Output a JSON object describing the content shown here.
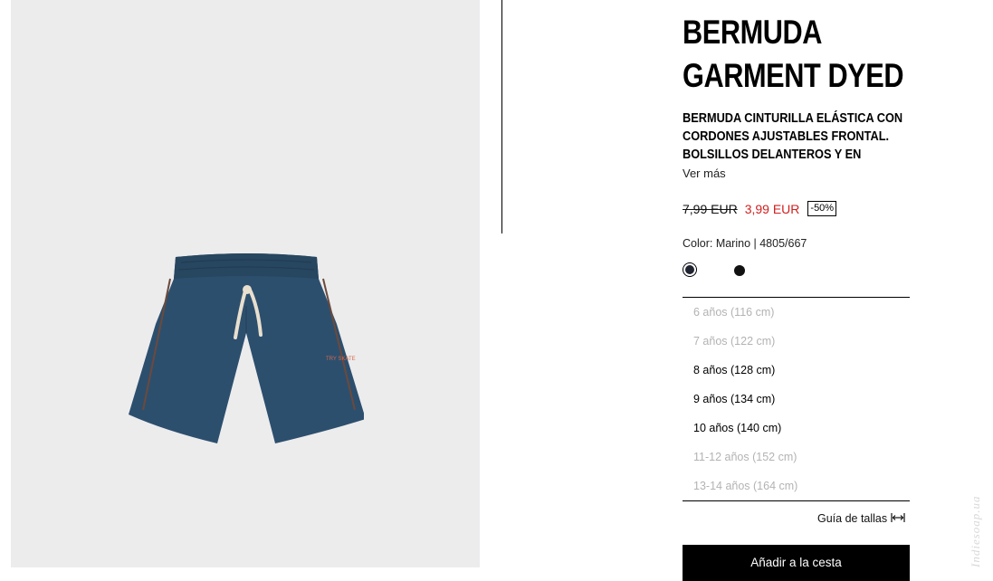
{
  "product": {
    "title_lines": [
      "BERMUDA",
      "GARMENT DYED"
    ],
    "description_lines": [
      "BERMUDA CINTURILLA ELÁSTICA CON",
      "CORDONES AJUSTABLES FRONTAL.",
      "BOLSILLOS DELANTEROS Y EN"
    ],
    "see_more": "Ver más",
    "price": {
      "old": "7,99 EUR",
      "new": "3,99 EUR",
      "discount": "-50%",
      "new_color": "#d01f1f"
    },
    "color_info": "Color: Marino | 4805/667",
    "swatches": [
      {
        "name": "Marino",
        "color": "#1f2430",
        "selected": true
      },
      {
        "name": "Negro",
        "color": "#111111",
        "selected": false
      }
    ],
    "sizes": [
      {
        "label": "6 años (116 cm)",
        "available": false
      },
      {
        "label": "7 años (122 cm)",
        "available": false
      },
      {
        "label": "8 años (128 cm)",
        "available": true
      },
      {
        "label": "9 años (134 cm)",
        "available": true
      },
      {
        "label": "10 años (140 cm)",
        "available": true
      },
      {
        "label": "11-12 años (152 cm)",
        "available": false
      },
      {
        "label": "13-14 años (164 cm)",
        "available": false
      }
    ],
    "size_guide": "Guía de tallas",
    "size_guide_icon": "ruler-arrows-icon",
    "add_to_cart": "Añadir a la cesta"
  },
  "image": {
    "background": "#ececed",
    "garment_color": "#2d4f6e",
    "drawstring_color": "#e8dfcf",
    "print_text": "TRY SKATE"
  },
  "watermark": "Indiesoap.ua"
}
